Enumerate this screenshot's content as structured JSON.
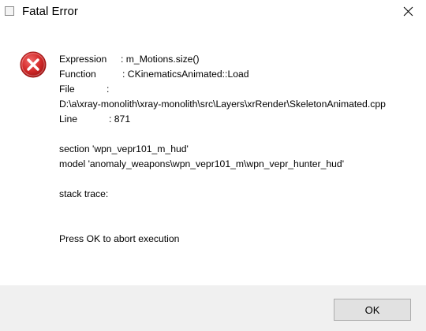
{
  "window": {
    "title": "Fatal Error",
    "close_icon": "close-icon"
  },
  "message": {
    "expression_label": "Expression",
    "expression_value": ": m_Motions.size()",
    "function_label": "Function",
    "function_value": ": CKinematicsAnimated::Load",
    "file_label": "File",
    "file_colon": ":",
    "file_path": "D:\\a\\xray-monolith\\xray-monolith\\src\\Layers\\xrRender\\SkeletonAnimated.cpp",
    "line_label": "Line",
    "line_value": ": 871",
    "section_line": "section 'wpn_vepr101_m_hud'",
    "model_line": "model 'anomaly_weapons\\wpn_vepr101_m\\wpn_vepr_hunter_hud'",
    "stack_trace": "stack trace:",
    "prompt": "Press OK to abort execution"
  },
  "buttons": {
    "ok_label": "OK"
  },
  "colors": {
    "error_red": "#d42b2b",
    "footer_bg": "#f0f0f0",
    "button_bg": "#e1e1e1",
    "button_border": "#adadad"
  }
}
